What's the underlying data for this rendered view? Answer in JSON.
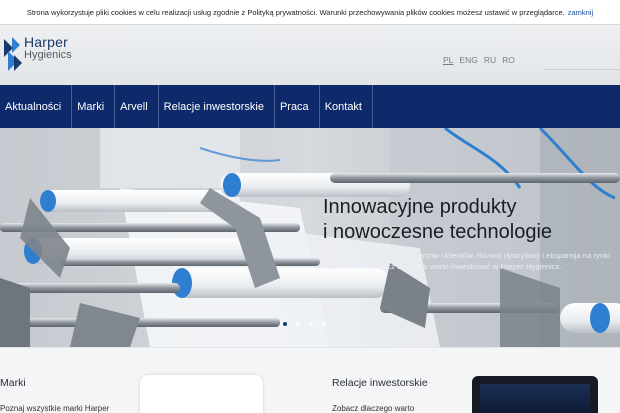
{
  "cookie_bar": {
    "text": "Strona wykorzystuje pliki cookies w celu realizacji usług zgodnie z Polityką prywatności. Warunki przechowywania plików cookies możesz ustawić w przeglądarce.",
    "close_label": "zamknij"
  },
  "logo": {
    "name": "Harper",
    "sub": "Hygienics"
  },
  "languages": [
    "PL",
    "ENG",
    "RU",
    "RO"
  ],
  "nav": [
    "Aktualności",
    "Marki",
    "Arvell",
    "Relacje inwestorskie",
    "Praca",
    "Kontakt"
  ],
  "hero": {
    "title_line1": "Innowacyjne produkty",
    "title_line2": "i nowoczesne technologie",
    "subtitle": "Znajomość potrzeb konsumentów i klientów. Rozwój dystrybucji i ekspansja na rynki zagraniczne. Zobacz dlaczego warto inwestować w Harper Hygienics."
  },
  "bottom": {
    "col1_title": "Marki",
    "col1_text": "Poznaj wszystkie marki Harper",
    "col2_title": "Relacje inwestorskie",
    "col2_text": "Zobacz dlaczego warto"
  },
  "colors": {
    "nav_bg": "#0f2a6b",
    "brand_blue": "#1b3a6b",
    "roller_blue": "#2f7fd1"
  }
}
